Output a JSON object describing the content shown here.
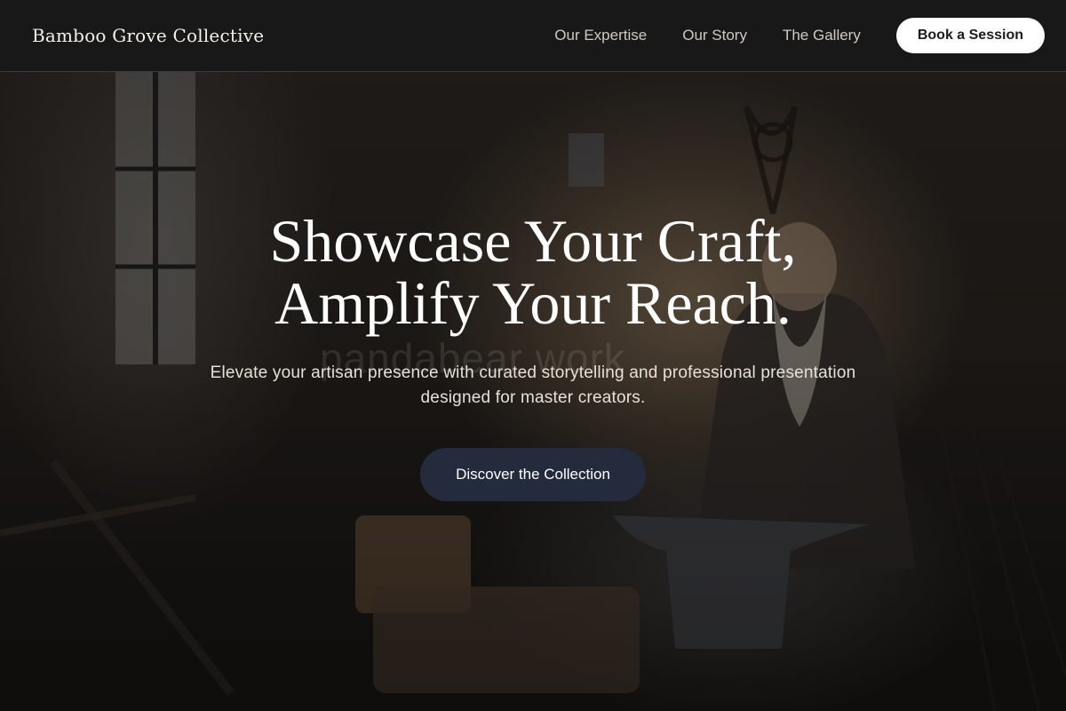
{
  "header": {
    "brand": "Bamboo Grove Collective",
    "nav": [
      {
        "label": "Our Expertise"
      },
      {
        "label": "Our Story"
      },
      {
        "label": "The Gallery"
      }
    ],
    "cta_label": "Book a Session"
  },
  "hero": {
    "title_line_1": "Showcase Your Craft,",
    "title_line_2": "Amplify Your Reach.",
    "subtitle_line_1": "Elevate your artisan presence with curated storytelling and professional presentation",
    "subtitle_line_2": "designed for master creators.",
    "cta_label": "Discover the Collection",
    "background_image": "blacksmith-workshop-photo",
    "watermark": "pandabear work"
  },
  "colors": {
    "header_bg": "#181818",
    "primary_button": "#232b3d",
    "header_button": "#ffffff"
  }
}
